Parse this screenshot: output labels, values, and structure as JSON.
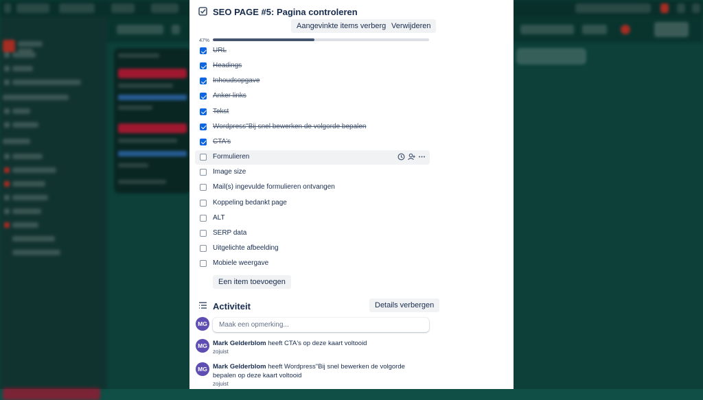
{
  "checklist": {
    "title": "SEO PAGE #5: Pagina controleren",
    "hide_checked_label": "Aangevinkte items verbergen",
    "delete_label": "Verwijderen",
    "progress_text": "47%",
    "progress": 0.47,
    "items": [
      {
        "label": "URL",
        "checked": true
      },
      {
        "label": "Headings",
        "checked": true
      },
      {
        "label": "Inhoudsopgave",
        "checked": true
      },
      {
        "label": "Anker links",
        "checked": true
      },
      {
        "label": "Tekst",
        "checked": true
      },
      {
        "label": "Wordpress\"Bij snel bewerken de volgorde bepalen",
        "checked": true
      },
      {
        "label": "CTA's",
        "checked": true
      },
      {
        "label": "Formulieren",
        "checked": false
      },
      {
        "label": "Image size",
        "checked": false
      },
      {
        "label": "Mail(s) ingevulde formulieren ontvangen",
        "checked": false
      },
      {
        "label": "Koppeling bedankt page",
        "checked": false
      },
      {
        "label": "ALT",
        "checked": false
      },
      {
        "label": "SERP data",
        "checked": false
      },
      {
        "label": "Uitgelichte afbeelding",
        "checked": false
      },
      {
        "label": "Mobiele weergave",
        "checked": false
      }
    ],
    "hovered_index": 7,
    "add_item_label": "Een item toevoegen"
  },
  "activity": {
    "title": "Activiteit",
    "hide_details_label": "Details verbergen",
    "comment_placeholder": "Maak een opmerking...",
    "user_initials": "MG",
    "entries": [
      {
        "initials": "MG",
        "user": "Mark Gelderblom",
        "text": "heeft CTA's op deze kaart voltooid",
        "time": "zojuist"
      },
      {
        "initials": "MG",
        "user": "Mark Gelderblom",
        "text": "heeft Wordpress\"Bij snel bewerken de volgorde bepalen op deze kaart voltooid",
        "time": "zojuist"
      }
    ]
  },
  "icons": {
    "checklist": "checklist-icon",
    "activity": "activity-icon",
    "due_date": "clock-icon",
    "assign": "assign-member-icon",
    "more": "more-icon"
  },
  "colors": {
    "checked": "#0c66e4",
    "avatar": "#5e4db2",
    "board_bg": "#0f4f46",
    "progress": "#44546f"
  }
}
